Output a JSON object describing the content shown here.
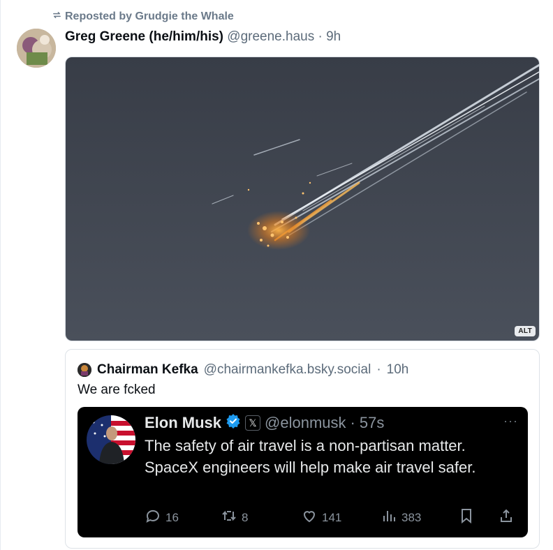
{
  "repost": {
    "label": "Reposted by Grudgie the Whale",
    "icon": "repost-icon"
  },
  "post": {
    "author_name": "Greg Greene (he/him/his)",
    "author_handle": "@greene.haus",
    "separator": "·",
    "time": "9h",
    "media_alt_badge": "ALT"
  },
  "quote": {
    "author_name": "Chairman Kefka",
    "author_handle": "@chairmankefka.bsky.social",
    "separator": "·",
    "time": "10h",
    "text": "We are fcked",
    "embedded_tweet": {
      "author_name": "Elon Musk",
      "x_badge": "𝕏",
      "handle": "@elonmusk",
      "separator": "·",
      "time": "57s",
      "more": "···",
      "text": "The safety of air travel is a non-partisan matter. SpaceX engineers will help make air travel safer.",
      "replies": "16",
      "reposts": "8",
      "likes": "141",
      "views": "383"
    }
  },
  "colors": {
    "verified": "#1d9bf0",
    "tweet_bg": "#000000",
    "muted": "#5c6b7a"
  }
}
